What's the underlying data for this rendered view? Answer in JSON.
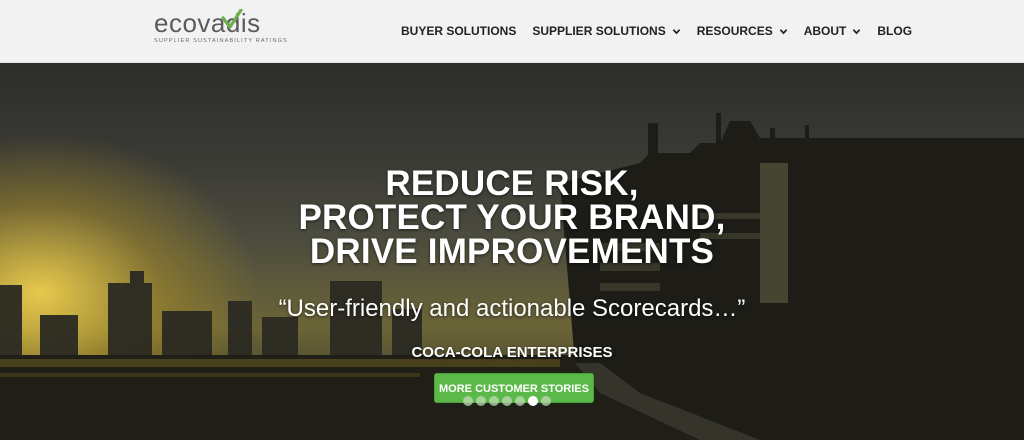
{
  "brand": {
    "name": "ecovadis",
    "tagline": "SUPPLIER SUSTAINABILITY RATINGS"
  },
  "nav": {
    "items": [
      {
        "label": "BUYER SOLUTIONS",
        "dropdown": false
      },
      {
        "label": "SUPPLIER SOLUTIONS",
        "dropdown": true,
        "icon": "chevron-down-icon"
      },
      {
        "label": "RESOURCES",
        "dropdown": true,
        "icon": "chevron-down-icon"
      },
      {
        "label": "ABOUT",
        "dropdown": true,
        "icon": "chevron-down-icon"
      },
      {
        "label": "BLOG",
        "dropdown": false
      }
    ]
  },
  "hero": {
    "headline": [
      "REDUCE RISK,",
      "PROTECT YOUR BRAND,",
      "DRIVE IMPROVEMENTS"
    ],
    "quote": "“User-friendly and actionable Scorecards…”",
    "company": "COCA-COLA ENTERPRISES",
    "cta_label": "MORE CUSTOMER STORIES",
    "carousel": {
      "total_slides": 7,
      "active_slide": 6
    }
  },
  "colors": {
    "accent_green": "#5bb94a",
    "logo_green": "#6ab04c",
    "nav_text": "#222222",
    "topbar_bg": "#f2f2f2"
  }
}
